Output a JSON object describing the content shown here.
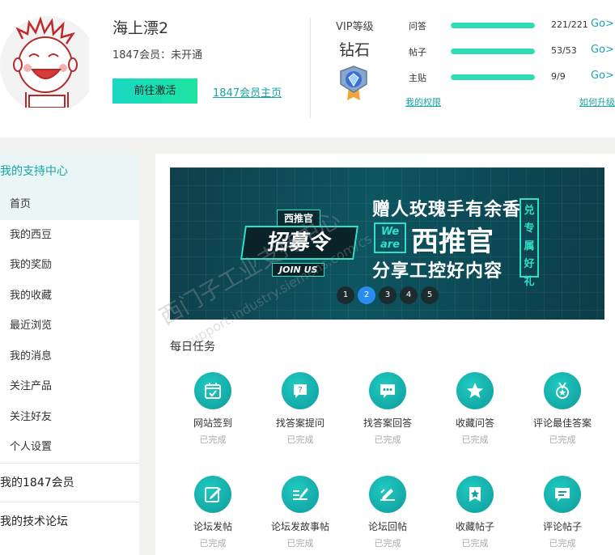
{
  "profile": {
    "username": "海上漂2",
    "membership": "1847会员：未开通",
    "activate_label": "前往激活",
    "homepage_label": "1847会员主页"
  },
  "vip": {
    "title": "VIP等级",
    "level": "钻石",
    "stats": [
      {
        "label": "问答",
        "count": "221/221",
        "fraction": 1.0,
        "go": "Go>"
      },
      {
        "label": "帖子",
        "count": "53/53",
        "fraction": 1.0,
        "go": "Go>"
      },
      {
        "label": "主贴",
        "count": "9/9",
        "fraction": 1.0,
        "go": "Go>"
      }
    ],
    "rights_label": "我的权限",
    "upgrade_label": "如何升级"
  },
  "sidebar": {
    "header": "我的支持中心",
    "items": [
      {
        "label": "首页",
        "active": true
      },
      {
        "label": "我的西豆"
      },
      {
        "label": "我的奖励"
      },
      {
        "label": "我的收藏"
      },
      {
        "label": "最近浏览"
      },
      {
        "label": "我的消息"
      },
      {
        "label": "关注产品"
      },
      {
        "label": "关注好友"
      },
      {
        "label": "个人设置"
      }
    ],
    "sections": [
      "我的1847会员",
      "我的技术论坛"
    ]
  },
  "banner": {
    "recruit_top": "西推官",
    "recruit_main": "招募令",
    "recruit_join": "JOIN US",
    "line1": "赠人玫瑰手有余香",
    "we_are": "We are",
    "line2": "西推官",
    "line3": "分享工控好内容",
    "gift": "兑专属好礼",
    "dots": [
      "1",
      "2",
      "3",
      "4",
      "5"
    ],
    "active_dot": 2,
    "watermark": "西门子工业支持中心",
    "watermark_url": "support.industry.siemens.com/cs"
  },
  "tasks": {
    "title": "每日任务",
    "items": [
      {
        "name": "网站签到",
        "status": "已完成",
        "icon": "calendar-check-icon"
      },
      {
        "name": "找答案提问",
        "status": "已完成",
        "icon": "question-bubble-icon"
      },
      {
        "name": "找答案回答",
        "status": "已完成",
        "icon": "chat-dots-icon"
      },
      {
        "name": "收藏问答",
        "status": "已完成",
        "icon": "star-icon"
      },
      {
        "name": "评论最佳答案",
        "status": "已完成",
        "icon": "medal-icon"
      },
      {
        "name": "论坛发帖",
        "status": "已完成",
        "icon": "edit-icon"
      },
      {
        "name": "论坛发故事帖",
        "status": "已完成",
        "icon": "pen-lines-icon"
      },
      {
        "name": "论坛回帖",
        "status": "已完成",
        "icon": "reply-pen-icon"
      },
      {
        "name": "收藏帖子",
        "status": "已完成",
        "icon": "star-badge-icon"
      },
      {
        "name": "评论帖子",
        "status": "已完成",
        "icon": "comment-icon"
      }
    ]
  },
  "colors": {
    "accent": "#16a5a5",
    "progress": "#2fdcb6",
    "task_icon": "#12a8a6",
    "active_dot": "#2a8cf0"
  }
}
